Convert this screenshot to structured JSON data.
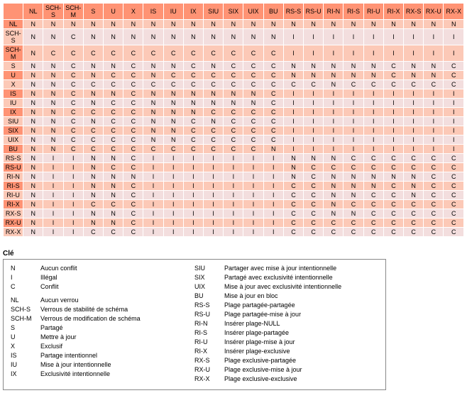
{
  "headers": [
    "NL",
    "SCH-S",
    "SCH-M",
    "S",
    "U",
    "X",
    "IS",
    "IU",
    "IX",
    "SIU",
    "SIX",
    "UIX",
    "BU",
    "RS-S",
    "RS-U",
    "RI-N",
    "RI-S",
    "RI-U",
    "RI-X",
    "RX-S",
    "RX-U",
    "RX-X"
  ],
  "rows": [
    {
      "label": "NL",
      "cells": [
        "N",
        "N",
        "N",
        "N",
        "N",
        "N",
        "N",
        "N",
        "N",
        "N",
        "N",
        "N",
        "N",
        "N",
        "N",
        "N",
        "N",
        "N",
        "N",
        "N",
        "N",
        "N"
      ]
    },
    {
      "label": "SCH-S",
      "cells": [
        "N",
        "N",
        "C",
        "N",
        "N",
        "N",
        "N",
        "N",
        "N",
        "N",
        "N",
        "N",
        "N",
        "I",
        "I",
        "I",
        "I",
        "I",
        "I",
        "I",
        "I",
        "I"
      ]
    },
    {
      "label": "SCH-M",
      "cells": [
        "N",
        "C",
        "C",
        "C",
        "C",
        "C",
        "C",
        "C",
        "C",
        "C",
        "C",
        "C",
        "C",
        "I",
        "I",
        "I",
        "I",
        "I",
        "I",
        "I",
        "I",
        "I"
      ]
    },
    {
      "label": "S",
      "cells": [
        "N",
        "N",
        "C",
        "N",
        "N",
        "C",
        "N",
        "N",
        "C",
        "N",
        "C",
        "C",
        "C",
        "N",
        "N",
        "N",
        "N",
        "N",
        "C",
        "N",
        "N",
        "C"
      ]
    },
    {
      "label": "U",
      "cells": [
        "N",
        "N",
        "C",
        "N",
        "C",
        "C",
        "N",
        "C",
        "C",
        "C",
        "C",
        "C",
        "C",
        "N",
        "N",
        "N",
        "N",
        "N",
        "C",
        "N",
        "N",
        "C"
      ]
    },
    {
      "label": "X",
      "cells": [
        "N",
        "N",
        "C",
        "C",
        "C",
        "C",
        "C",
        "C",
        "C",
        "C",
        "C",
        "C",
        "C",
        "C",
        "C",
        "N",
        "C",
        "C",
        "C",
        "C",
        "C",
        "C"
      ]
    },
    {
      "label": "IS",
      "cells": [
        "N",
        "N",
        "C",
        "N",
        "N",
        "C",
        "N",
        "N",
        "N",
        "N",
        "N",
        "N",
        "C",
        "I",
        "I",
        "I",
        "I",
        "I",
        "I",
        "I",
        "I",
        "I"
      ]
    },
    {
      "label": "IU",
      "cells": [
        "N",
        "N",
        "C",
        "N",
        "C",
        "C",
        "N",
        "N",
        "N",
        "N",
        "N",
        "N",
        "C",
        "I",
        "I",
        "I",
        "I",
        "I",
        "I",
        "I",
        "I",
        "I"
      ]
    },
    {
      "label": "IX",
      "cells": [
        "N",
        "N",
        "C",
        "C",
        "C",
        "C",
        "N",
        "N",
        "N",
        "C",
        "C",
        "C",
        "C",
        "I",
        "I",
        "I",
        "I",
        "I",
        "I",
        "I",
        "I",
        "I"
      ]
    },
    {
      "label": "SIU",
      "cells": [
        "N",
        "N",
        "C",
        "N",
        "C",
        "C",
        "N",
        "N",
        "C",
        "N",
        "C",
        "C",
        "C",
        "I",
        "I",
        "I",
        "I",
        "I",
        "I",
        "I",
        "I",
        "I"
      ]
    },
    {
      "label": "SIX",
      "cells": [
        "N",
        "N",
        "C",
        "C",
        "C",
        "C",
        "N",
        "N",
        "C",
        "C",
        "C",
        "C",
        "C",
        "I",
        "I",
        "I",
        "I",
        "I",
        "I",
        "I",
        "I",
        "I"
      ]
    },
    {
      "label": "UIX",
      "cells": [
        "N",
        "N",
        "C",
        "C",
        "C",
        "C",
        "N",
        "N",
        "C",
        "C",
        "C",
        "C",
        "C",
        "I",
        "I",
        "I",
        "I",
        "I",
        "I",
        "I",
        "I",
        "I"
      ]
    },
    {
      "label": "BU",
      "cells": [
        "N",
        "N",
        "C",
        "C",
        "C",
        "C",
        "C",
        "C",
        "C",
        "C",
        "C",
        "C",
        "N",
        "I",
        "I",
        "I",
        "I",
        "I",
        "I",
        "I",
        "I",
        "I"
      ]
    },
    {
      "label": "RS-S",
      "cells": [
        "N",
        "I",
        "I",
        "N",
        "N",
        "C",
        "I",
        "I",
        "I",
        "I",
        "I",
        "I",
        "I",
        "N",
        "N",
        "N",
        "C",
        "C",
        "C",
        "C",
        "C",
        "C"
      ]
    },
    {
      "label": "RS-U",
      "cells": [
        "N",
        "I",
        "I",
        "N",
        "C",
        "C",
        "I",
        "I",
        "I",
        "I",
        "I",
        "I",
        "I",
        "N",
        "C",
        "C",
        "C",
        "C",
        "C",
        "C",
        "C",
        "C"
      ]
    },
    {
      "label": "RI-N",
      "cells": [
        "N",
        "I",
        "I",
        "N",
        "N",
        "N",
        "I",
        "I",
        "I",
        "I",
        "I",
        "I",
        "I",
        "N",
        "C",
        "N",
        "N",
        "N",
        "N",
        "N",
        "C",
        "C"
      ]
    },
    {
      "label": "RI-S",
      "cells": [
        "N",
        "I",
        "I",
        "N",
        "N",
        "C",
        "I",
        "I",
        "I",
        "I",
        "I",
        "I",
        "I",
        "C",
        "C",
        "N",
        "N",
        "N",
        "C",
        "N",
        "C",
        "C"
      ]
    },
    {
      "label": "RI-U",
      "cells": [
        "N",
        "I",
        "I",
        "N",
        "N",
        "C",
        "I",
        "I",
        "I",
        "I",
        "I",
        "I",
        "I",
        "C",
        "C",
        "N",
        "N",
        "C",
        "C",
        "N",
        "C",
        "C"
      ]
    },
    {
      "label": "RI-X",
      "cells": [
        "N",
        "I",
        "I",
        "C",
        "C",
        "C",
        "I",
        "I",
        "I",
        "I",
        "I",
        "I",
        "I",
        "C",
        "C",
        "N",
        "C",
        "C",
        "C",
        "C",
        "C",
        "C"
      ]
    },
    {
      "label": "RX-S",
      "cells": [
        "N",
        "I",
        "I",
        "N",
        "N",
        "C",
        "I",
        "I",
        "I",
        "I",
        "I",
        "I",
        "I",
        "C",
        "C",
        "N",
        "N",
        "C",
        "C",
        "C",
        "C",
        "C"
      ]
    },
    {
      "label": "RX-U",
      "cells": [
        "N",
        "I",
        "I",
        "N",
        "N",
        "C",
        "I",
        "I",
        "I",
        "I",
        "I",
        "I",
        "I",
        "C",
        "C",
        "C",
        "C",
        "C",
        "C",
        "C",
        "C",
        "C"
      ]
    },
    {
      "label": "RX-X",
      "cells": [
        "N",
        "I",
        "I",
        "C",
        "C",
        "C",
        "I",
        "I",
        "I",
        "I",
        "I",
        "I",
        "I",
        "C",
        "C",
        "C",
        "C",
        "C",
        "C",
        "C",
        "C",
        "C"
      ]
    }
  ],
  "key": {
    "title": "Clé",
    "col1a": [
      {
        "abbr": "N",
        "desc": "Aucun conflit"
      },
      {
        "abbr": "I",
        "desc": "Illégal"
      },
      {
        "abbr": "C",
        "desc": "Conflit"
      }
    ],
    "col1b": [
      {
        "abbr": "NL",
        "desc": "Aucun verrou"
      },
      {
        "abbr": "SCH-S",
        "desc": "Verrous de stabilité de schéma"
      },
      {
        "abbr": "SCH-M",
        "desc": "Verrous de modification de schéma"
      },
      {
        "abbr": "S",
        "desc": "Partagé"
      },
      {
        "abbr": "U",
        "desc": "Mettre à jour"
      },
      {
        "abbr": "X",
        "desc": "Exclusif"
      },
      {
        "abbr": "IS",
        "desc": "Partage intentionnel"
      },
      {
        "abbr": "IU",
        "desc": "Mise à jour intentionnelle"
      },
      {
        "abbr": "IX",
        "desc": "Exclusivité intentionnelle"
      }
    ],
    "col2": [
      {
        "abbr": "SIU",
        "desc": "Partager avec mise à jour intentionnelle"
      },
      {
        "abbr": "SIX",
        "desc": "Partagé avec exclusivité intentionnelle"
      },
      {
        "abbr": "UIX",
        "desc": "Mise à jour avec exclusivité intentionnelle"
      },
      {
        "abbr": "BU",
        "desc": "Mise à jour en bloc"
      },
      {
        "abbr": "RS-S",
        "desc": "Plage partagée-partagée"
      },
      {
        "abbr": "RS-U",
        "desc": "Plage partagée-mise à jour"
      },
      {
        "abbr": "RI-N",
        "desc": "Insérer plage-NULL"
      },
      {
        "abbr": "RI-S",
        "desc": "Insérer plage-partagée"
      },
      {
        "abbr": "RI-U",
        "desc": "Insérer plage-mise à jour"
      },
      {
        "abbr": "RI-X",
        "desc": "Insérer plage-exclusive"
      },
      {
        "abbr": "RX-S",
        "desc": "Plage exclusive-partagée"
      },
      {
        "abbr": "RX-U",
        "desc": "Plage exclusive-mise à jour"
      },
      {
        "abbr": "RX-X",
        "desc": "Plage exclusive-exclusive"
      }
    ]
  }
}
